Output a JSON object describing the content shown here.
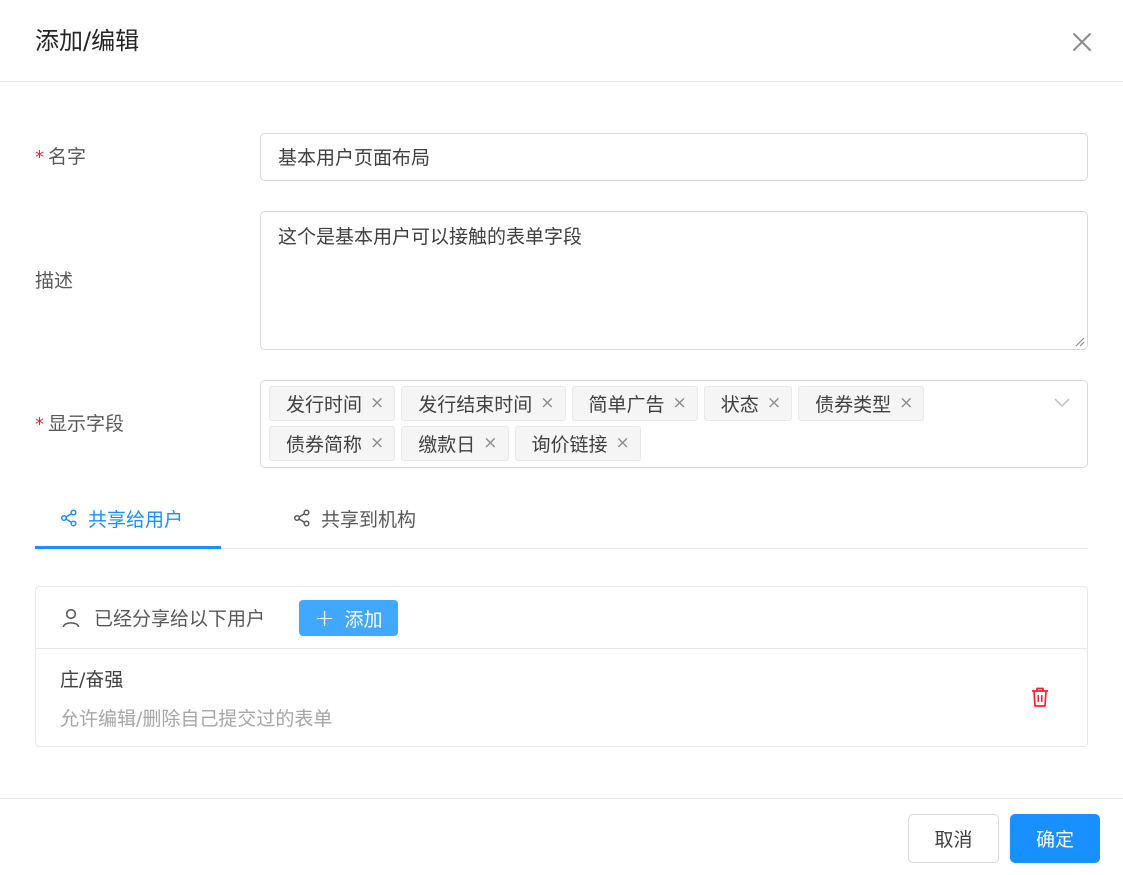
{
  "header": {
    "title": "添加/编辑"
  },
  "form": {
    "name_label": "名字",
    "name_value": "基本用户页面布局",
    "desc_label": "描述",
    "desc_value": "这个是基本用户可以接触的表单字段",
    "fields_label": "显示字段",
    "fields_tags": [
      "发行时间",
      "发行结束时间",
      "简单广告",
      "状态",
      "债券类型",
      "债券简称",
      "缴款日",
      "询价链接"
    ]
  },
  "tabs": [
    {
      "label": "共享给用户",
      "active": true
    },
    {
      "label": "共享到机构",
      "active": false
    }
  ],
  "share": {
    "header_text": "已经分享给以下用户",
    "add_label": "添加",
    "users": [
      {
        "name": "庄/奋强",
        "permission": "允许编辑/删除自己提交过的表单"
      }
    ]
  },
  "footer": {
    "cancel_label": "取消",
    "ok_label": "确定"
  },
  "colors": {
    "primary": "#1890ff",
    "add_button": "#40a9ff",
    "required": "#f5222d",
    "danger": "#f5222d"
  }
}
